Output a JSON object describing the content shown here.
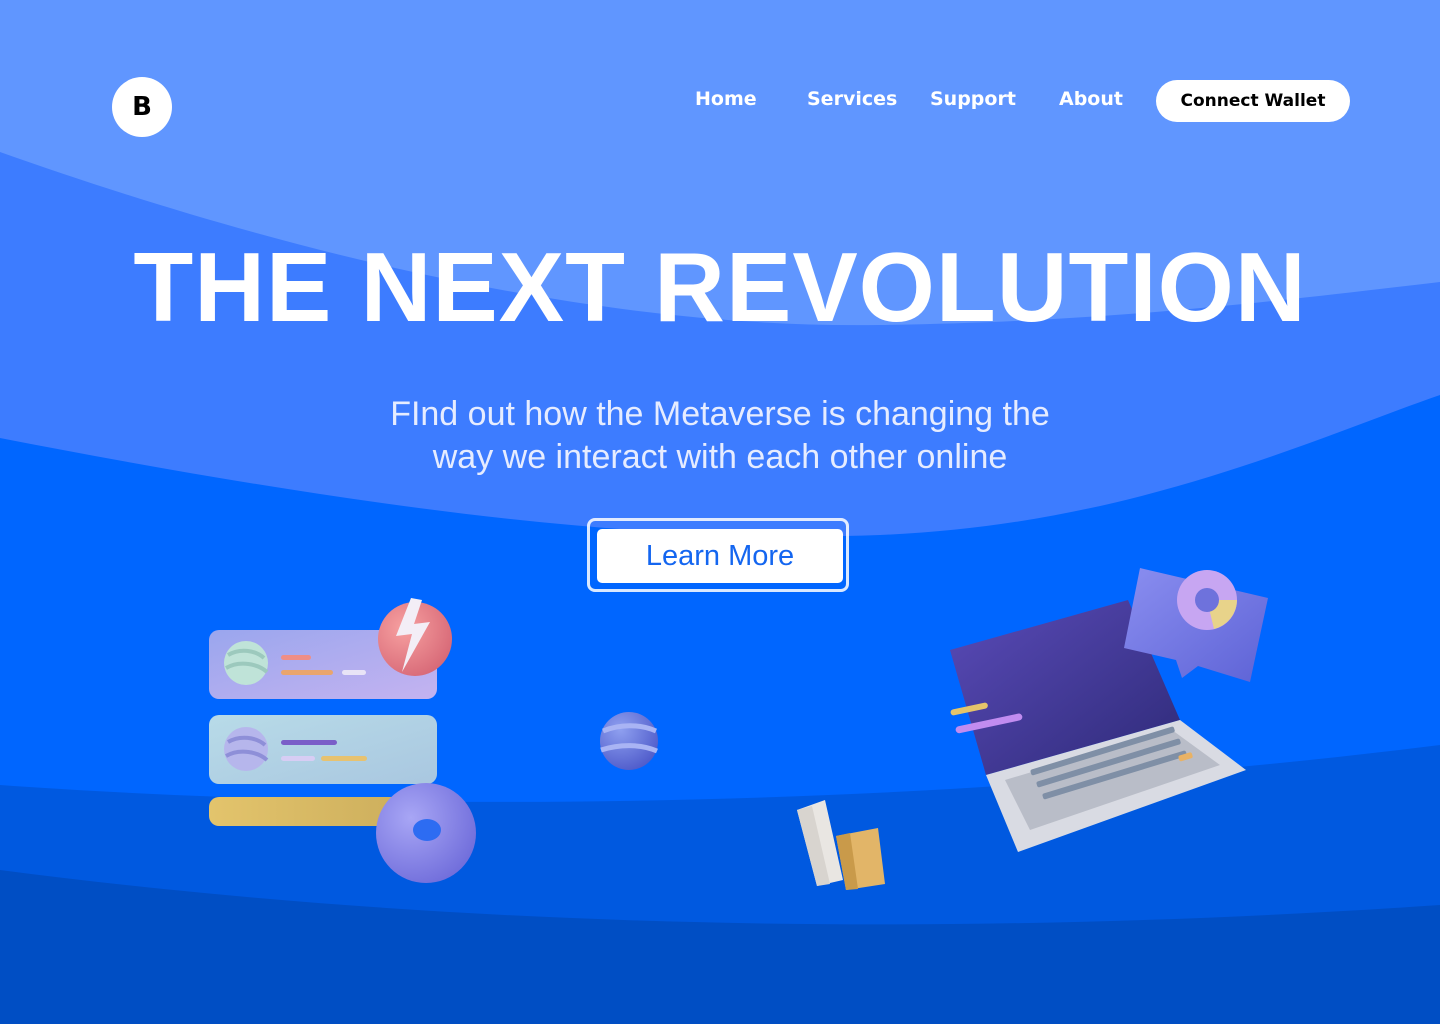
{
  "logo": {
    "letter": "B"
  },
  "nav": {
    "items": [
      {
        "label": "Home"
      },
      {
        "label": "Services"
      },
      {
        "label": "Support"
      },
      {
        "label": "About"
      }
    ],
    "connect_label": "Connect Wallet"
  },
  "hero": {
    "title": "THE NEXT REVOLUTION",
    "subtitle_line1": "FInd out how the Metaverse is changing the",
    "subtitle_line2": "way we interact with each other online",
    "cta_label": "Learn More"
  },
  "colors": {
    "bg_top": "#6096ff",
    "bg_mid": "#3d7cff",
    "bg_main": "#0066ff",
    "bg_low": "#0059e0",
    "bg_bottom": "#004ec4",
    "accent": "#1466f0"
  },
  "icons": [
    "card-stack-icon",
    "lightning-orb-icon",
    "donut-ring-icon",
    "striped-sphere-icon",
    "laptop-icon",
    "pie-chart-bubble-icon",
    "bar-blocks-icon"
  ]
}
